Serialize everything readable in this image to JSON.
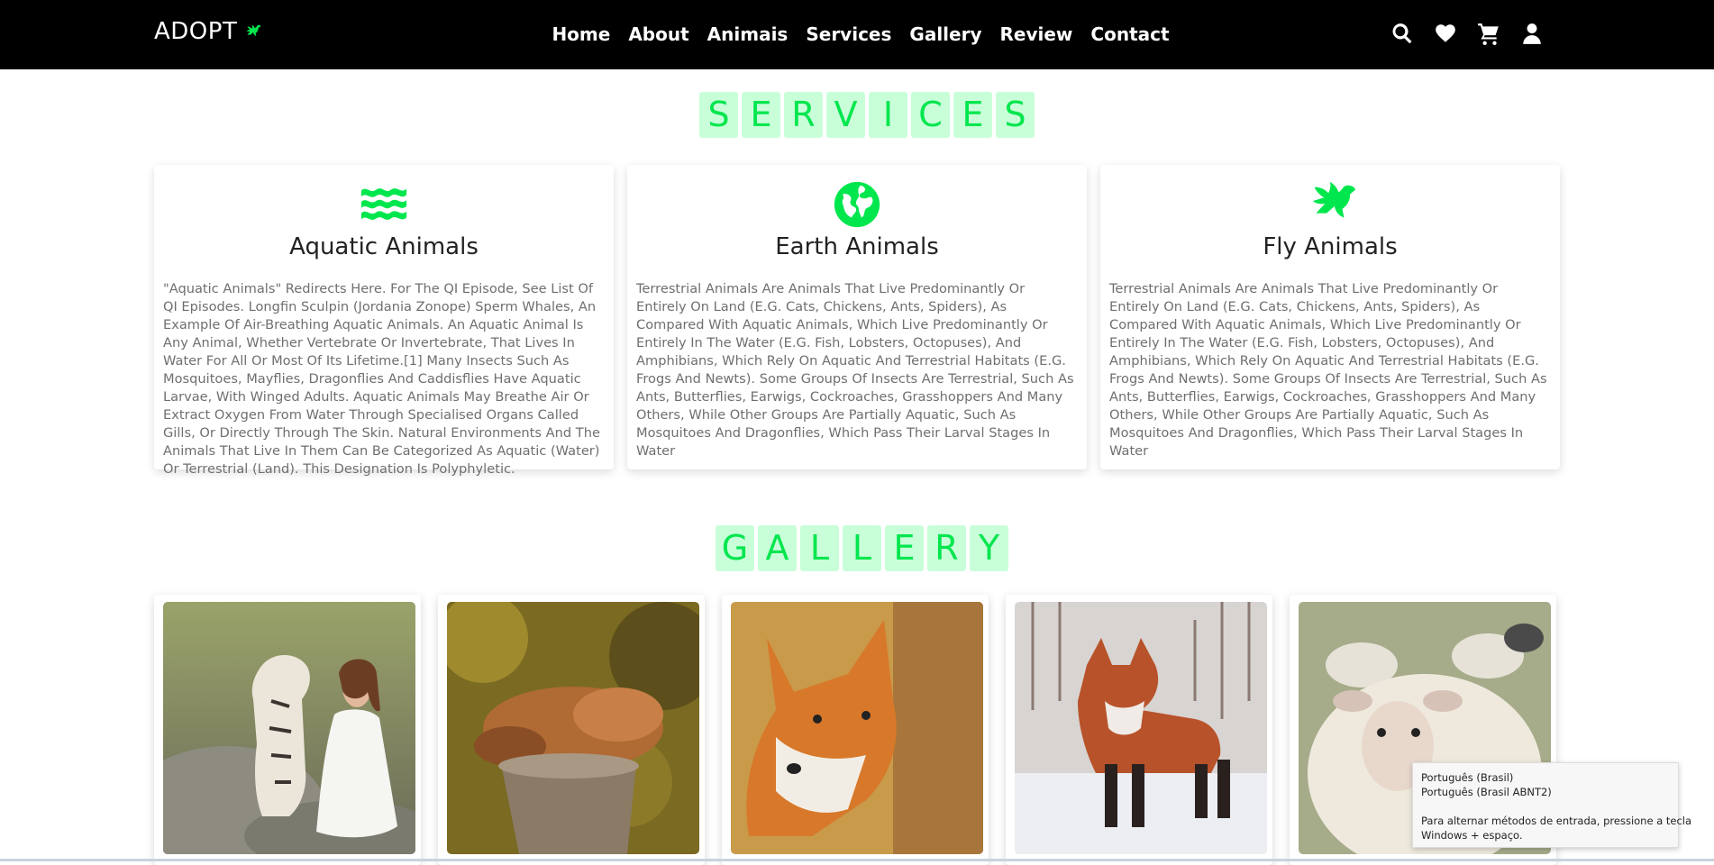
{
  "nav": {
    "logo": "ADOPT",
    "links": [
      "Home",
      "About",
      "Animais",
      "Services",
      "Gallery",
      "Review",
      "Contact"
    ],
    "icons": [
      "search-icon",
      "heart-icon",
      "cart-icon",
      "user-icon"
    ]
  },
  "services": {
    "heading_letters": [
      "S",
      "E",
      "R",
      "V",
      "I",
      "C",
      "E",
      "S"
    ],
    "cards": [
      {
        "icon": "water-icon",
        "title": "Aquatic Animals",
        "text": "\"Aquatic Animals\" Redirects Here. For The QI Episode, See List Of QI Episodes. Longfin Sculpin (Jordania Zonope) Sperm Whales, An Example Of Air-Breathing Aquatic Animals. An Aquatic Animal Is Any Animal, Whether Vertebrate Or Invertebrate, That Lives In Water For All Or Most Of Its Lifetime.[1] Many Insects Such As Mosquitoes, Mayflies, Dragonflies And Caddisflies Have Aquatic Larvae, With Winged Adults. Aquatic Animals May Breathe Air Or Extract Oxygen From Water Through Specialised Organs Called Gills, Or Directly Through The Skin. Natural Environments And The Animals That Live In Them Can Be Categorized As Aquatic (Water) Or Terrestrial (Land). This Designation Is Polyphyletic."
      },
      {
        "icon": "globe-icon",
        "title": "Earth Animals",
        "text": "Terrestrial Animals Are Animals That Live Predominantly Or Entirely On Land (E.G. Cats, Chickens, Ants, Spiders), As Compared With Aquatic Animals, Which Live Predominantly Or Entirely In The Water (E.G. Fish, Lobsters, Octopuses), And Amphibians, Which Rely On Aquatic And Terrestrial Habitats (E.G. Frogs And Newts). Some Groups Of Insects Are Terrestrial, Such As Ants, Butterflies, Earwigs, Cockroaches, Grasshoppers And Many Others, While Other Groups Are Partially Aquatic, Such As Mosquitoes And Dragonflies, Which Pass Their Larval Stages In Water"
      },
      {
        "icon": "dove-icon",
        "title": "Fly Animals",
        "text": "Terrestrial Animals Are Animals That Live Predominantly Or Entirely On Land (E.G. Cats, Chickens, Ants, Spiders), As Compared With Aquatic Animals, Which Live Predominantly Or Entirely In The Water (E.G. Fish, Lobsters, Octopuses), And Amphibians, Which Rely On Aquatic And Terrestrial Habitats (E.G. Frogs And Newts). Some Groups Of Insects Are Terrestrial, Such As Ants, Butterflies, Earwigs, Cockroaches, Grasshoppers And Many Others, While Other Groups Are Partially Aquatic, Such As Mosquitoes And Dragonflies, Which Pass Their Larval Stages In Water"
      }
    ]
  },
  "gallery": {
    "heading_letters": [
      "G",
      "A",
      "L",
      "L",
      "E",
      "R",
      "Y"
    ],
    "images": [
      "tiger-and-woman-photo",
      "sleeping-fox-on-stump-photo",
      "fox-portrait-photo",
      "fox-in-snow-photo",
      "sheep-photo"
    ]
  },
  "ime_popup": {
    "line1": "Português (Brasil)",
    "line2": "Português (Brasil ABNT2)",
    "line3": "Para alternar métodos de entrada, pressione a tecla",
    "line4": "Windows + espaço."
  },
  "colors": {
    "accent": "#00e64d",
    "heading_bg": "#c8ffd9",
    "navbar": "#000000"
  }
}
